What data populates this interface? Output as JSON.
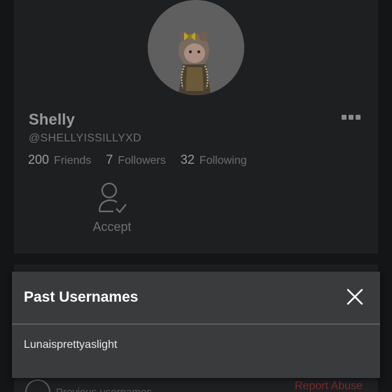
{
  "profile": {
    "display_name": "Shelly",
    "username": "@SHELLYISSILLYXD",
    "stats": [
      {
        "value": "200",
        "label": "Friends"
      },
      {
        "value": "7",
        "label": "Followers"
      },
      {
        "value": "32",
        "label": "Following"
      }
    ],
    "accept_label": "Accept",
    "more_icon": "more-horizontal-icon"
  },
  "footer": {
    "previous_usernames_label": "Previous usernames",
    "report_abuse_label": "Report Abuse",
    "report_color": "#7a2b2b"
  },
  "modal": {
    "title": "Past Usernames",
    "close_icon": "close-icon",
    "items": [
      "Lunaisprettyaslight"
    ]
  }
}
